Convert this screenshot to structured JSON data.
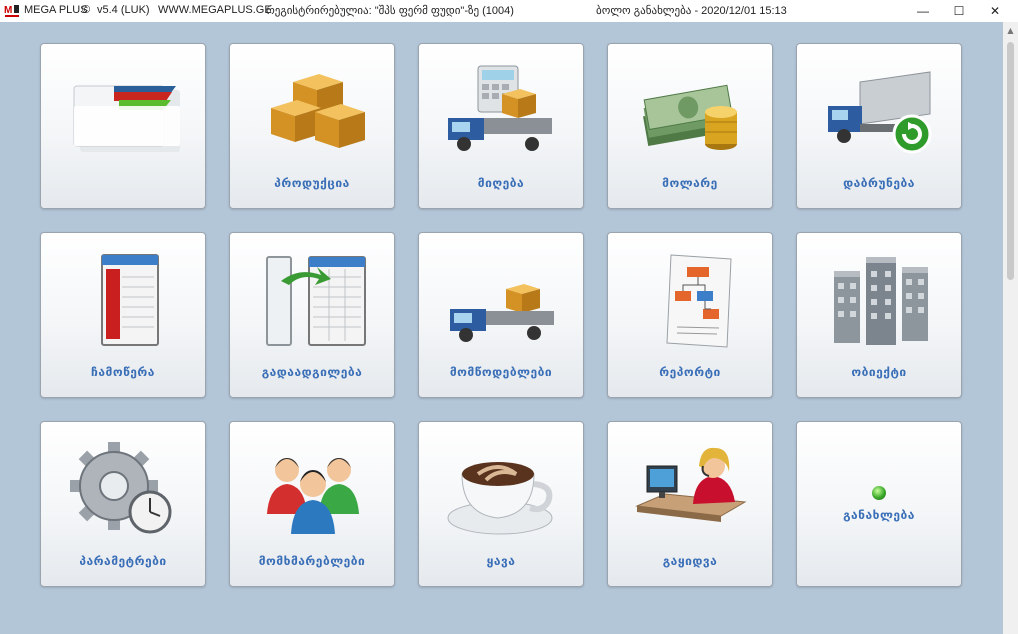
{
  "titlebar": {
    "app": "MEGA PLUS",
    "copyright": "©",
    "version": "v5.4 (LUK)",
    "website": "WWW.MEGAPLUS.GE",
    "registration": "რეგისტრირებულია: \"შპს ფერმ ფუდი\"-ზე (1004)",
    "last_update": "ბოლო განახლება - 2020/12/01 15:13"
  },
  "window_controls": {
    "minimize": "—",
    "maximize": "☐",
    "close": "✕"
  },
  "tiles": [
    {
      "label": "",
      "icon": "folders-icon"
    },
    {
      "label": "პროდუქცია",
      "icon": "boxes-icon"
    },
    {
      "label": "მიღება",
      "icon": "receiving-truck-icon"
    },
    {
      "label": "მოლარე",
      "icon": "money-icon"
    },
    {
      "label": "დაბრუნება",
      "icon": "return-truck-icon"
    },
    {
      "label": "ჩამოწერა",
      "icon": "writeoff-sheet-icon"
    },
    {
      "label": "გადაადგილება",
      "icon": "transfer-sheet-icon"
    },
    {
      "label": "მომწოდებლები",
      "icon": "supplier-truck-icon"
    },
    {
      "label": "რეპორტი",
      "icon": "report-icon"
    },
    {
      "label": "ობიექტი",
      "icon": "buildings-icon"
    },
    {
      "label": "პარამეტრები",
      "icon": "gear-icon"
    },
    {
      "label": "მომხმარებლები",
      "icon": "users-icon"
    },
    {
      "label": "ყავა",
      "icon": "coffee-icon"
    },
    {
      "label": "გაყიდვა",
      "icon": "sales-operator-icon"
    },
    {
      "label": "განახლება",
      "icon": "update-dot-icon"
    }
  ]
}
